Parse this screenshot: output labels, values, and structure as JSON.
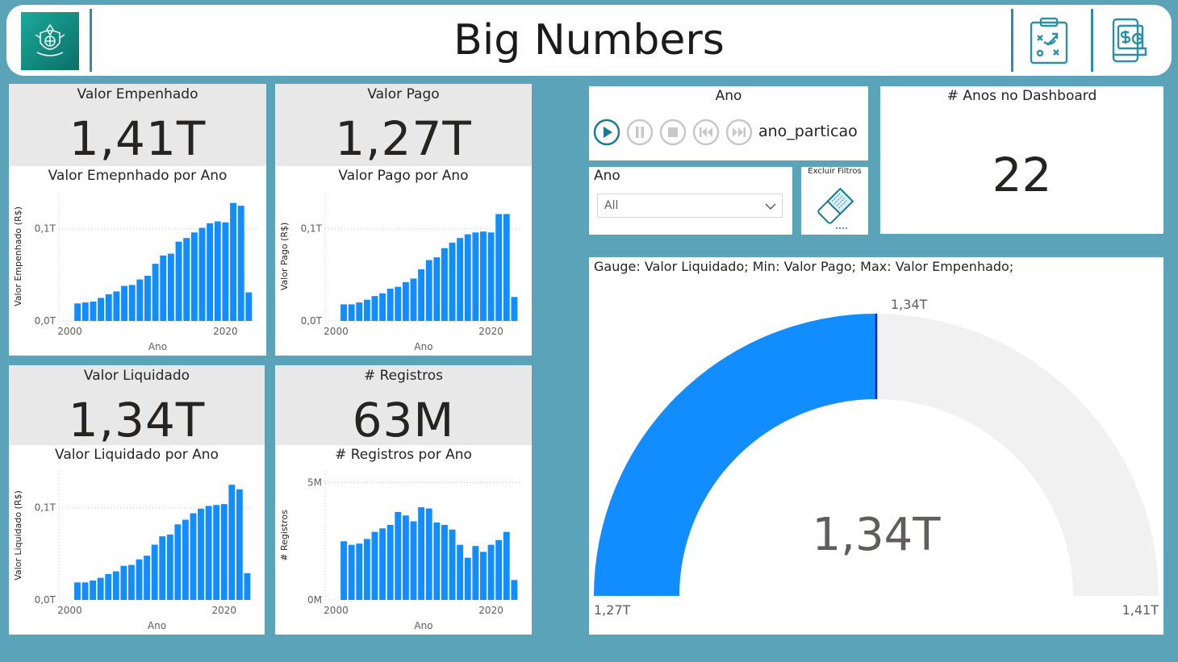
{
  "header": {
    "title": "Big Numbers"
  },
  "kpis": [
    {
      "label": "Valor Empenhado",
      "value": "1,41T",
      "chart_title": "Valor Emepnhado por Ano",
      "ylabel": "Valor Empenhado (R$)",
      "xlabel": "Ano",
      "ytick_top": "0,1T",
      "ytick_bottom": "0,0T",
      "xtick_left": "2000",
      "xtick_right": "2020"
    },
    {
      "label": "Valor Pago",
      "value": "1,27T",
      "chart_title": "Valor Pago por Ano",
      "ylabel": "Valor Pago (R$)",
      "xlabel": "Ano",
      "ytick_top": "0,1T",
      "ytick_bottom": "0,0T",
      "xtick_left": "2000",
      "xtick_right": "2020"
    },
    {
      "label": "Valor Liquidado",
      "value": "1,34T",
      "chart_title": "Valor Liquidado por Ano",
      "ylabel": "Valor Liquidado (R$)",
      "xlabel": "Ano",
      "ytick_top": "0,1T",
      "ytick_bottom": "0,0T",
      "xtick_left": "2000",
      "xtick_right": "2020"
    },
    {
      "label": "# Registros",
      "value": "63M",
      "chart_title": "# Registros por Ano",
      "ylabel": "# Registros",
      "xlabel": "Ano",
      "ytick_top": "5M",
      "ytick_bottom": "0M",
      "xtick_left": "2000",
      "xtick_right": "2020"
    }
  ],
  "chart_data": [
    {
      "type": "bar",
      "xlabel": "Ano",
      "ylabel": "Valor Empenhado (R$)",
      "x": [
        2001,
        2002,
        2003,
        2004,
        2005,
        2006,
        2007,
        2008,
        2009,
        2010,
        2011,
        2012,
        2013,
        2014,
        2015,
        2016,
        2017,
        2018,
        2019,
        2020,
        2021,
        2022,
        2023
      ],
      "values": [
        0.019,
        0.02,
        0.021,
        0.025,
        0.029,
        0.032,
        0.038,
        0.039,
        0.045,
        0.049,
        0.062,
        0.071,
        0.073,
        0.086,
        0.09,
        0.096,
        0.101,
        0.106,
        0.108,
        0.107,
        0.128,
        0.125,
        0.031
      ],
      "ylim": [
        0,
        0.14
      ]
    },
    {
      "type": "bar",
      "xlabel": "Ano",
      "ylabel": "Valor Pago (R$)",
      "x": [
        2001,
        2002,
        2003,
        2004,
        2005,
        2006,
        2007,
        2008,
        2009,
        2010,
        2011,
        2012,
        2013,
        2014,
        2015,
        2016,
        2017,
        2018,
        2019,
        2020,
        2021,
        2022,
        2023
      ],
      "values": [
        0.018,
        0.018,
        0.02,
        0.023,
        0.027,
        0.03,
        0.035,
        0.037,
        0.042,
        0.046,
        0.056,
        0.066,
        0.069,
        0.079,
        0.085,
        0.09,
        0.094,
        0.096,
        0.097,
        0.096,
        0.116,
        0.116,
        0.026
      ],
      "ylim": [
        0,
        0.14
      ]
    },
    {
      "type": "bar",
      "xlabel": "Ano",
      "ylabel": "Valor Liquidado (R$)",
      "x": [
        2001,
        2002,
        2003,
        2004,
        2005,
        2006,
        2007,
        2008,
        2009,
        2010,
        2011,
        2012,
        2013,
        2014,
        2015,
        2016,
        2017,
        2018,
        2019,
        2020,
        2021,
        2022,
        2023
      ],
      "values": [
        0.019,
        0.019,
        0.021,
        0.024,
        0.028,
        0.031,
        0.037,
        0.038,
        0.044,
        0.048,
        0.06,
        0.069,
        0.071,
        0.082,
        0.087,
        0.094,
        0.099,
        0.102,
        0.103,
        0.104,
        0.125,
        0.12,
        0.029
      ],
      "ylim": [
        0,
        0.14
      ]
    },
    {
      "type": "bar",
      "xlabel": "Ano",
      "ylabel": "# Registros",
      "x": [
        2001,
        2002,
        2003,
        2004,
        2005,
        2006,
        2007,
        2008,
        2009,
        2010,
        2011,
        2012,
        2013,
        2014,
        2015,
        2016,
        2017,
        2018,
        2019,
        2020,
        2021,
        2022,
        2023
      ],
      "values": [
        2.5,
        2.35,
        2.4,
        2.6,
        2.9,
        3.05,
        3.2,
        3.75,
        3.6,
        3.35,
        3.95,
        3.9,
        3.3,
        3.2,
        3.0,
        2.35,
        1.8,
        2.3,
        2.05,
        2.35,
        2.55,
        2.9,
        0.85
      ],
      "ylim": [
        0,
        5.5
      ]
    }
  ],
  "play_axis": {
    "title": "Ano",
    "field": "ano_particao"
  },
  "ano_slicer": {
    "title": "Ano",
    "selected": "All"
  },
  "clear_filters": {
    "label": "Excluir Filtros"
  },
  "years_card": {
    "label": "# Anos no Dashboard",
    "value": "22"
  },
  "gauge": {
    "title": "Gauge: Valor Liquidado; Min: Valor Pago; Max: Valor Empenhado;",
    "value": 1.34,
    "min": 1.27,
    "max": 1.41,
    "value_label": "1,34T",
    "min_label": "1,27T",
    "max_label": "1,41T",
    "target_label": "1,34T",
    "fill_color": "#118DFF",
    "track_color": "#F1F1F1",
    "target_color": "#12239E"
  },
  "colors": {
    "background": "#5BA3B8",
    "bar": "#118DFF",
    "accent": "#2C8FA6"
  }
}
